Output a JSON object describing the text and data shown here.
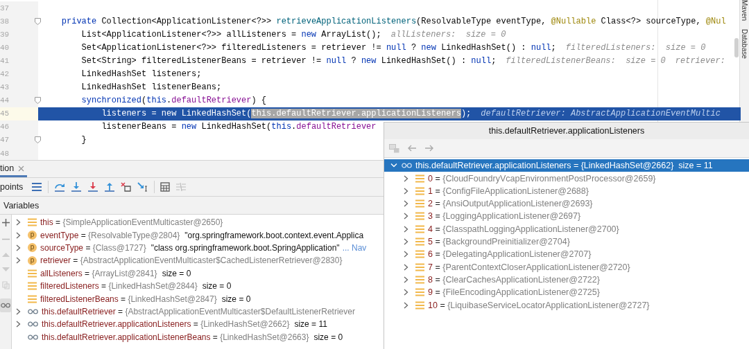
{
  "editor": {
    "lines": [
      {
        "number": "37",
        "highlighted": false,
        "fold": false
      },
      {
        "number": "38",
        "highlighted": false,
        "fold": true,
        "segments": [
          {
            "text": "    private ",
            "kind": "kw"
          },
          {
            "text": "Collection<ApplicationListener<?>> ",
            "kind": "plain"
          },
          {
            "text": "retrieveApplicationListeners",
            "kind": "method"
          },
          {
            "text": "(ResolvableType eventType, ",
            "kind": "plain"
          },
          {
            "text": "@Nullable ",
            "kind": "annot"
          },
          {
            "text": "Class<?> sourceType, ",
            "kind": "plain"
          },
          {
            "text": "@Nul",
            "kind": "annot"
          }
        ]
      },
      {
        "number": "39",
        "highlighted": false,
        "fold": false,
        "segments": [
          {
            "text": "        List<ApplicationListener<?>> allListeners = ",
            "kind": "plain"
          },
          {
            "text": "new ",
            "kind": "kw"
          },
          {
            "text": "ArrayList();",
            "kind": "plain"
          }
        ],
        "hints": [
          "allListeners:  size = 0"
        ]
      },
      {
        "number": "40",
        "highlighted": false,
        "fold": false,
        "segments": [
          {
            "text": "        Set<ApplicationListener<?>> filteredListeners = retriever != ",
            "kind": "plain"
          },
          {
            "text": "null",
            "kind": "kw"
          },
          {
            "text": " ? ",
            "kind": "plain"
          },
          {
            "text": "new ",
            "kind": "kw"
          },
          {
            "text": "LinkedHashSet() : ",
            "kind": "plain"
          },
          {
            "text": "null",
            "kind": "kw"
          },
          {
            "text": ";",
            "kind": "plain"
          }
        ],
        "hints": [
          "filteredListeners:  size = 0"
        ]
      },
      {
        "number": "41",
        "highlighted": false,
        "fold": false,
        "segments": [
          {
            "text": "        Set<String> filteredListenerBeans = retriever != ",
            "kind": "plain"
          },
          {
            "text": "null",
            "kind": "kw"
          },
          {
            "text": " ? ",
            "kind": "plain"
          },
          {
            "text": "new ",
            "kind": "kw"
          },
          {
            "text": "LinkedHashSet() : ",
            "kind": "plain"
          },
          {
            "text": "null",
            "kind": "kw"
          },
          {
            "text": ";",
            "kind": "plain"
          }
        ],
        "hints": [
          "filteredListenerBeans:  size = 0",
          "retriever:"
        ]
      },
      {
        "number": "42",
        "highlighted": false,
        "fold": false,
        "segments": [
          {
            "text": "        LinkedHashSet listeners;",
            "kind": "plain"
          }
        ]
      },
      {
        "number": "43",
        "highlighted": false,
        "fold": false,
        "segments": [
          {
            "text": "        LinkedHashSet listenerBeans;",
            "kind": "plain"
          }
        ]
      },
      {
        "number": "44",
        "highlighted": false,
        "fold": true,
        "segments": [
          {
            "text": "        synchronized",
            "kind": "kw"
          },
          {
            "text": "(",
            "kind": "plain"
          },
          {
            "text": "this",
            "kind": "kw"
          },
          {
            "text": ".",
            "kind": "plain"
          },
          {
            "text": "defaultRetriever",
            "kind": "field"
          },
          {
            "text": ") {",
            "kind": "plain"
          }
        ]
      },
      {
        "number": "45",
        "highlighted": true,
        "fold": false,
        "segments": [
          {
            "text": "            listeners = new LinkedHashSet(",
            "kind": "plain"
          },
          {
            "text": "this.defaultRetriever.applicationListeners",
            "kind": "selection"
          },
          {
            "text": ");",
            "kind": "plain"
          }
        ],
        "hints": [
          "defaultRetriever: AbstractApplicationEventMultic"
        ]
      },
      {
        "number": "46",
        "highlighted": false,
        "fold": false,
        "segments": [
          {
            "text": "            listenerBeans = ",
            "kind": "plain"
          },
          {
            "text": "new ",
            "kind": "kw"
          },
          {
            "text": "LinkedHashSet(",
            "kind": "plain"
          },
          {
            "text": "this",
            "kind": "kw"
          },
          {
            "text": ".",
            "kind": "plain"
          },
          {
            "text": "defaultRetriever",
            "kind": "field"
          }
        ]
      },
      {
        "number": "47",
        "highlighted": false,
        "fold": true,
        "segments": [
          {
            "text": "        }",
            "kind": "plain"
          }
        ]
      },
      {
        "number": "48",
        "highlighted": false,
        "fold": false
      }
    ]
  },
  "tool_strip": [
    "Maven",
    "Database"
  ],
  "debug_panel": {
    "tab": {
      "label": "tion",
      "selected": true
    },
    "toolbar_label": "points",
    "section_title": "Variables",
    "variables": [
      {
        "kind": "field",
        "expandable": true,
        "name": "this",
        "sign": "=",
        "ref": "{SimpleApplicationEventMulticaster@2650}"
      },
      {
        "kind": "param",
        "badge": "p",
        "expandable": true,
        "name": "eventType",
        "sign": "=",
        "ref": "{ResolvableType@2804}",
        "extra": "\"org.springframework.boot.context.event.Applica"
      },
      {
        "kind": "param",
        "badge": "p",
        "expandable": true,
        "name": "sourceType",
        "sign": "=",
        "ref": "{Class@1727}",
        "extra": "\"class org.springframework.boot.SpringApplication\"",
        "link": "... Nav"
      },
      {
        "kind": "param",
        "badge": "p",
        "expandable": true,
        "name": "retriever",
        "sign": "=",
        "ref": "{AbstractApplicationEventMulticaster$CachedListenerRetriever@2830}"
      },
      {
        "kind": "field",
        "expandable": false,
        "name": "allListeners",
        "sign": "=",
        "ref": "{ArrayList@2841}",
        "extra": "size = 0"
      },
      {
        "kind": "field",
        "expandable": false,
        "name": "filteredListeners",
        "sign": "=",
        "ref": "{LinkedHashSet@2844}",
        "extra": "size = 0"
      },
      {
        "kind": "field",
        "expandable": false,
        "name": "filteredListenerBeans",
        "sign": "=",
        "ref": "{LinkedHashSet@2847}",
        "extra": "size = 0"
      },
      {
        "kind": "watch",
        "expandable": true,
        "name": "this.defaultRetriever",
        "sign": "=",
        "ref": "{AbstractApplicationEventMulticaster$DefaultListenerRetriever"
      },
      {
        "kind": "watch",
        "expandable": true,
        "name": "this.defaultRetriever.applicationListeners",
        "sign": "=",
        "ref": "{LinkedHashSet@2662}",
        "extra": "size = 11"
      },
      {
        "kind": "watch",
        "expandable": false,
        "name": "this.defaultRetriever.applicationListenerBeans",
        "sign": "=",
        "ref": "{LinkedHashSet@2663}",
        "extra": "size = 0"
      }
    ]
  },
  "popup": {
    "title": "this.defaultRetriever.applicationListeners",
    "root": {
      "label": "this.defaultRetriever.applicationListeners = {LinkedHashSet@2662}  size = 11",
      "selected": true,
      "expanded": true,
      "children": [
        {
          "index": "0",
          "sign": "=",
          "value": "{CloudFoundryVcapEnvironmentPostProcessor@2659}"
        },
        {
          "index": "1",
          "sign": "=",
          "value": "{ConfigFileApplicationListener@2688}"
        },
        {
          "index": "2",
          "sign": "=",
          "value": "{AnsiOutputApplicationListener@2693}"
        },
        {
          "index": "3",
          "sign": "=",
          "value": "{LoggingApplicationListener@2697}"
        },
        {
          "index": "4",
          "sign": "=",
          "value": "{ClasspathLoggingApplicationListener@2700}"
        },
        {
          "index": "5",
          "sign": "=",
          "value": "{BackgroundPreinitializer@2704}"
        },
        {
          "index": "6",
          "sign": "=",
          "value": "{DelegatingApplicationListener@2707}"
        },
        {
          "index": "7",
          "sign": "=",
          "value": "{ParentContextCloserApplicationListener@2720}"
        },
        {
          "index": "8",
          "sign": "=",
          "value": "{ClearCachesApplicationListener@2722}"
        },
        {
          "index": "9",
          "sign": "=",
          "value": "{FileEncodingApplicationListener@2725}"
        },
        {
          "index": "10",
          "sign": "=",
          "value": "{LiquibaseServiceLocatorApplicationListener@2727}"
        }
      ]
    }
  }
}
